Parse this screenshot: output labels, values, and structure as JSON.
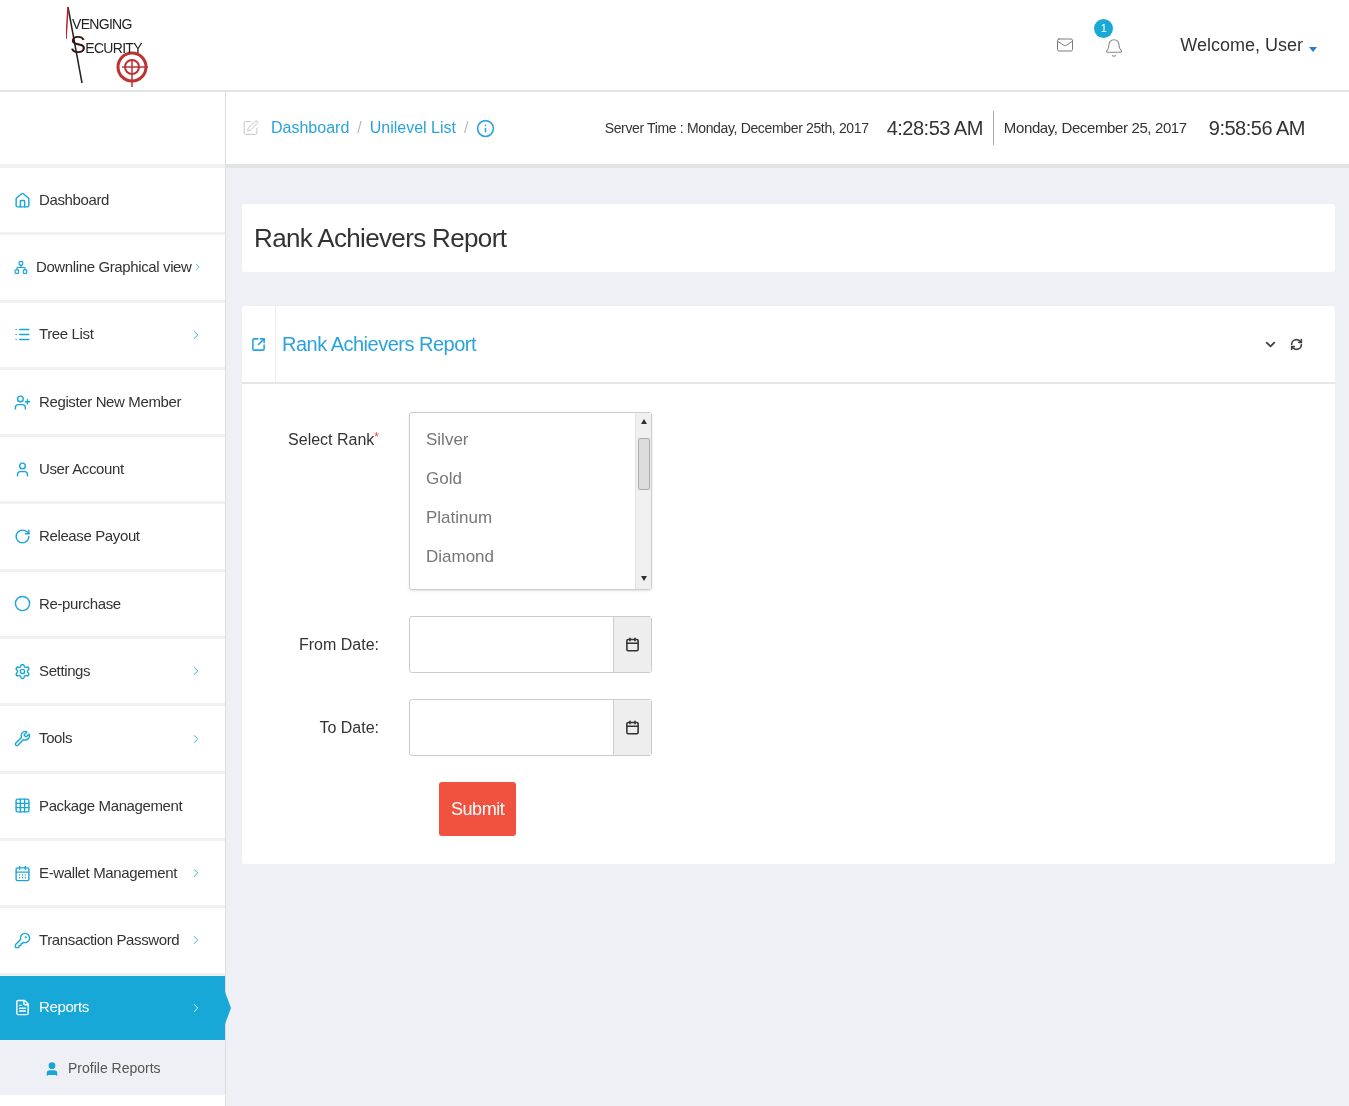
{
  "logo": {
    "line1": "VENGING",
    "line2": "SECURITY"
  },
  "header": {
    "notifications": "1",
    "welcome": "Welcome, User"
  },
  "breadcrumbs": [
    {
      "label": "Dashboard",
      "separator": "/"
    },
    {
      "label": "Unilevel List",
      "separator": "/"
    }
  ],
  "server_time": {
    "label": "Server Time : Monday, December 25th, 2017",
    "time": "4:28:53 AM",
    "local_date": "Monday, December 25, 2017",
    "local_time": "9:58:56 AM"
  },
  "sidebar": {
    "items": [
      {
        "label": "Dashboard",
        "chevron": false,
        "selected": false
      },
      {
        "label": "Downline Graphical view",
        "chevron": true,
        "selected": false
      },
      {
        "label": "Tree List",
        "chevron": true,
        "selected": false
      },
      {
        "label": "Register New Member",
        "chevron": false,
        "selected": false
      },
      {
        "label": "User Account",
        "chevron": false,
        "selected": false
      },
      {
        "label": "Release Payout",
        "chevron": false,
        "selected": false
      },
      {
        "label": "Re-purchase",
        "chevron": false,
        "selected": false
      },
      {
        "label": "Settings",
        "chevron": true,
        "selected": false
      },
      {
        "label": "Tools",
        "chevron": true,
        "selected": false
      },
      {
        "label": "Package Management",
        "chevron": false,
        "selected": false
      },
      {
        "label": "E-wallet Management",
        "chevron": true,
        "selected": false
      },
      {
        "label": "Transaction Password",
        "chevron": true,
        "selected": false
      },
      {
        "label": "Reports",
        "chevron": true,
        "selected": true,
        "children": [
          {
            "label": "Profile Reports"
          }
        ]
      }
    ]
  },
  "page_title": "Rank Achievers Report",
  "panel": {
    "title": "Rank Achievers Report",
    "form": {
      "rank_label": "Select Rank",
      "required_mark": "*",
      "ranks": [
        "Silver",
        "Gold",
        "Platinum",
        "Diamond"
      ],
      "from_label": "From Date:",
      "to_label": "To Date:",
      "submit": "Submit"
    }
  }
}
